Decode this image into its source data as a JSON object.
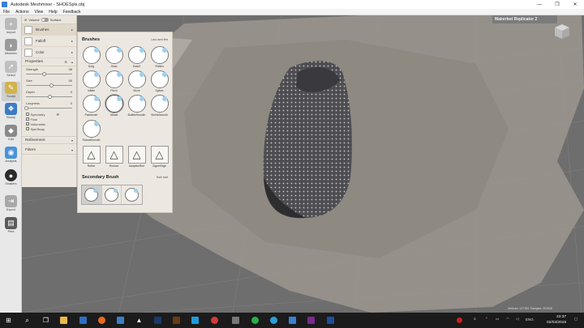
{
  "window": {
    "title": "Autodesk Meshmixer - SHOESpls.obj",
    "minimize": "—",
    "maximize": "❐",
    "close": "✕"
  },
  "menu": [
    "File",
    "Actions",
    "View",
    "Help",
    "Feedback"
  ],
  "left_toolbar": [
    {
      "label": "Import",
      "icon": "plus-icon",
      "color": "#b9b9b9"
    },
    {
      "label": "Meshmix",
      "icon": "bunny-icon",
      "color": "#9a9a9a"
    },
    {
      "label": "Select",
      "icon": "cursor-icon",
      "color": "#c0c0c0"
    },
    {
      "label": "Sculpt",
      "icon": "brush-icon",
      "color": "#d2b24c"
    },
    {
      "label": "Stamp",
      "icon": "stamp-icon",
      "color": "#3d7bc4"
    },
    {
      "label": "Edit",
      "icon": "edit-icon",
      "color": "#8a8a8a"
    },
    {
      "label": "Analysis",
      "icon": "analysis-icon",
      "color": "#4b93d6"
    },
    {
      "label": "Shaders",
      "icon": "shader-sphere-icon",
      "color": "#2b2b2b"
    },
    {
      "label": "Export",
      "icon": "export-icon",
      "color": "#a8a8a8"
    },
    {
      "label": "Print",
      "icon": "print-icon",
      "color": "#5a5a5a"
    }
  ],
  "brush_panel": {
    "volume_label": "Volume",
    "surface_label": "Surface",
    "brushes_label": "Brushes",
    "falloff_label": "Falloff",
    "color_label": "Color",
    "properties_label": "Properties",
    "sliders": [
      {
        "label": "Strength",
        "value": "38",
        "pct": 0.38
      },
      {
        "label": "Size",
        "value": "55",
        "pct": 0.55
      },
      {
        "label": "Depth",
        "value": "0",
        "pct": 0.5
      },
      {
        "label": "Lazyness",
        "value": "0",
        "pct": 0.0
      }
    ],
    "checks": [
      {
        "label": "Symmetry",
        "checked": false
      },
      {
        "label": "Flow",
        "checked": true
      },
      {
        "label": "Volumetric",
        "checked": true
      },
      {
        "label": "SymSnap",
        "checked": false
      }
    ],
    "refinement_label": "Refinement",
    "filters_label": "Filters"
  },
  "brushes": {
    "title": "Brushes",
    "sub_label": "Last used first",
    "items": [
      {
        "name": "Drag"
      },
      {
        "name": "Draw"
      },
      {
        "name": "Draw2"
      },
      {
        "name": "Flatten"
      },
      {
        "name": "Inflate"
      },
      {
        "name": "Pinch"
      },
      {
        "name": "Move"
      },
      {
        "name": "Spikes"
      },
      {
        "name": "Paintbrush"
      },
      {
        "name": "Attract"
      },
      {
        "name": "BubbleSmooth"
      },
      {
        "name": "ShrinkSmooth"
      },
      {
        "name": "RobustSmooth"
      }
    ],
    "refine_items": [
      {
        "name": "Refine"
      },
      {
        "name": "Reduce"
      },
      {
        "name": "AdaptiveRed"
      },
      {
        "name": "ZipperEdge"
      }
    ],
    "secondary_title": "Secondary Brush",
    "secondary_sub": "Both hold"
  },
  "viewport": {
    "printer_label": "Makerbot Replicator 2",
    "stats": "Vertices: 127769  Triangles: 251526"
  },
  "taskbar": {
    "lang": "ENG",
    "time": "23:37",
    "date": "02/03/2018"
  }
}
